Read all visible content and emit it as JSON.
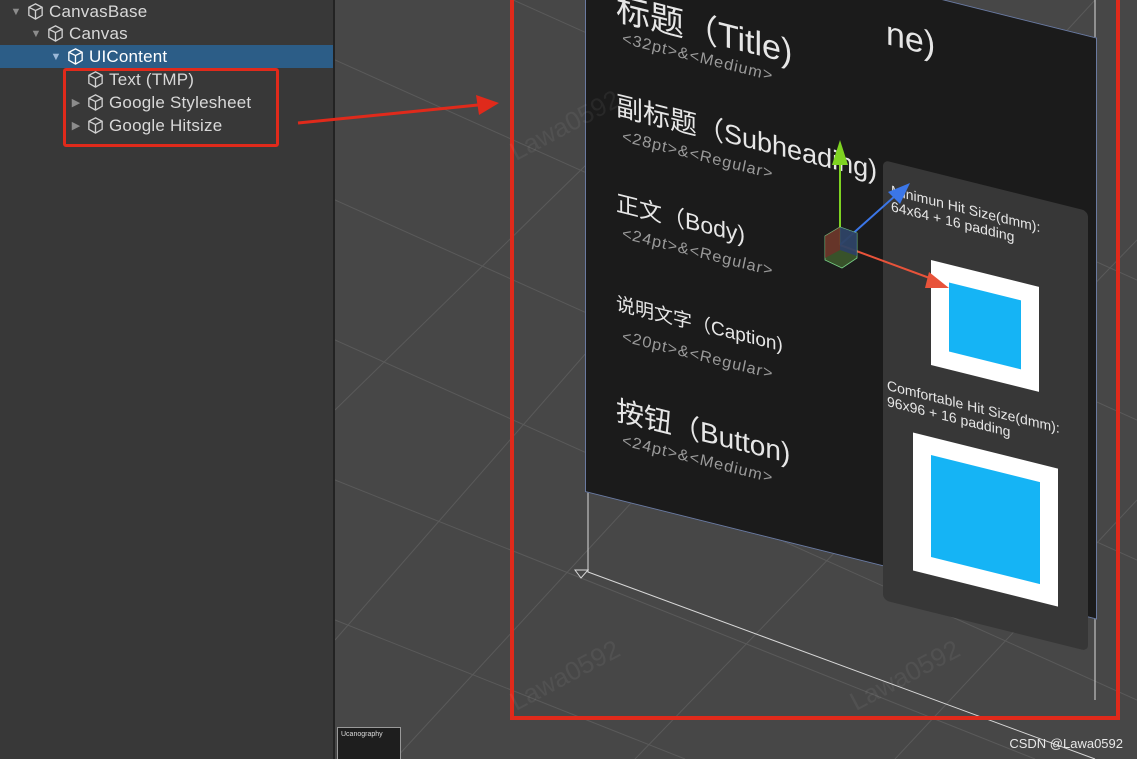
{
  "hierarchy": {
    "items": [
      {
        "label": "CanvasBase",
        "depth": 0,
        "foldout": "▼",
        "selected": false
      },
      {
        "label": "Canvas",
        "depth": 1,
        "foldout": "▼",
        "selected": false
      },
      {
        "label": "UIContent",
        "depth": 2,
        "foldout": "▼",
        "selected": true
      },
      {
        "label": "Text (TMP)",
        "depth": 3,
        "foldout": "",
        "selected": false
      },
      {
        "label": "Google Stylesheet",
        "depth": 3,
        "foldout": "▶",
        "selected": false
      },
      {
        "label": "Google Hitsize",
        "depth": 3,
        "foldout": "▶",
        "selected": false
      }
    ]
  },
  "scene": {
    "styles": [
      {
        "title": "标题（Title)",
        "spec": "<32pt>&<Medium>"
      },
      {
        "title": "副标题（Subheading)",
        "spec": "<28pt>&<Regular>"
      },
      {
        "title": "正文（Body)",
        "spec": "<24pt>&<Regular>"
      },
      {
        "title": "说明文字（Caption)",
        "spec": "<20pt>&<Regular>"
      },
      {
        "title": "按钮（Button)",
        "spec": "<24pt>&<Medium>"
      }
    ],
    "top_partial": "ne)",
    "hit_min": {
      "title": "Minimun Hit Size(dmm):",
      "subtitle": "64x64 + 16 padding"
    },
    "hit_comfort": {
      "title": "Comfortable Hit Size(dmm):",
      "subtitle": "96x96 + 16 padding"
    },
    "thumbnail_label": "Ucanography",
    "faint_watermark": "Lawa0592"
  },
  "watermark": "CSDN @Lawa0592",
  "colors": {
    "accent_red": "#e02a1b",
    "selection_blue": "#2c5d87",
    "hit_cyan": "#15b4f5",
    "gizmo_x": "#e8533a",
    "gizmo_y": "#7ed321",
    "gizmo_z": "#3b76e8"
  },
  "icons": {
    "gameobject": "cube-icon",
    "foldout": "triangle-icon"
  }
}
